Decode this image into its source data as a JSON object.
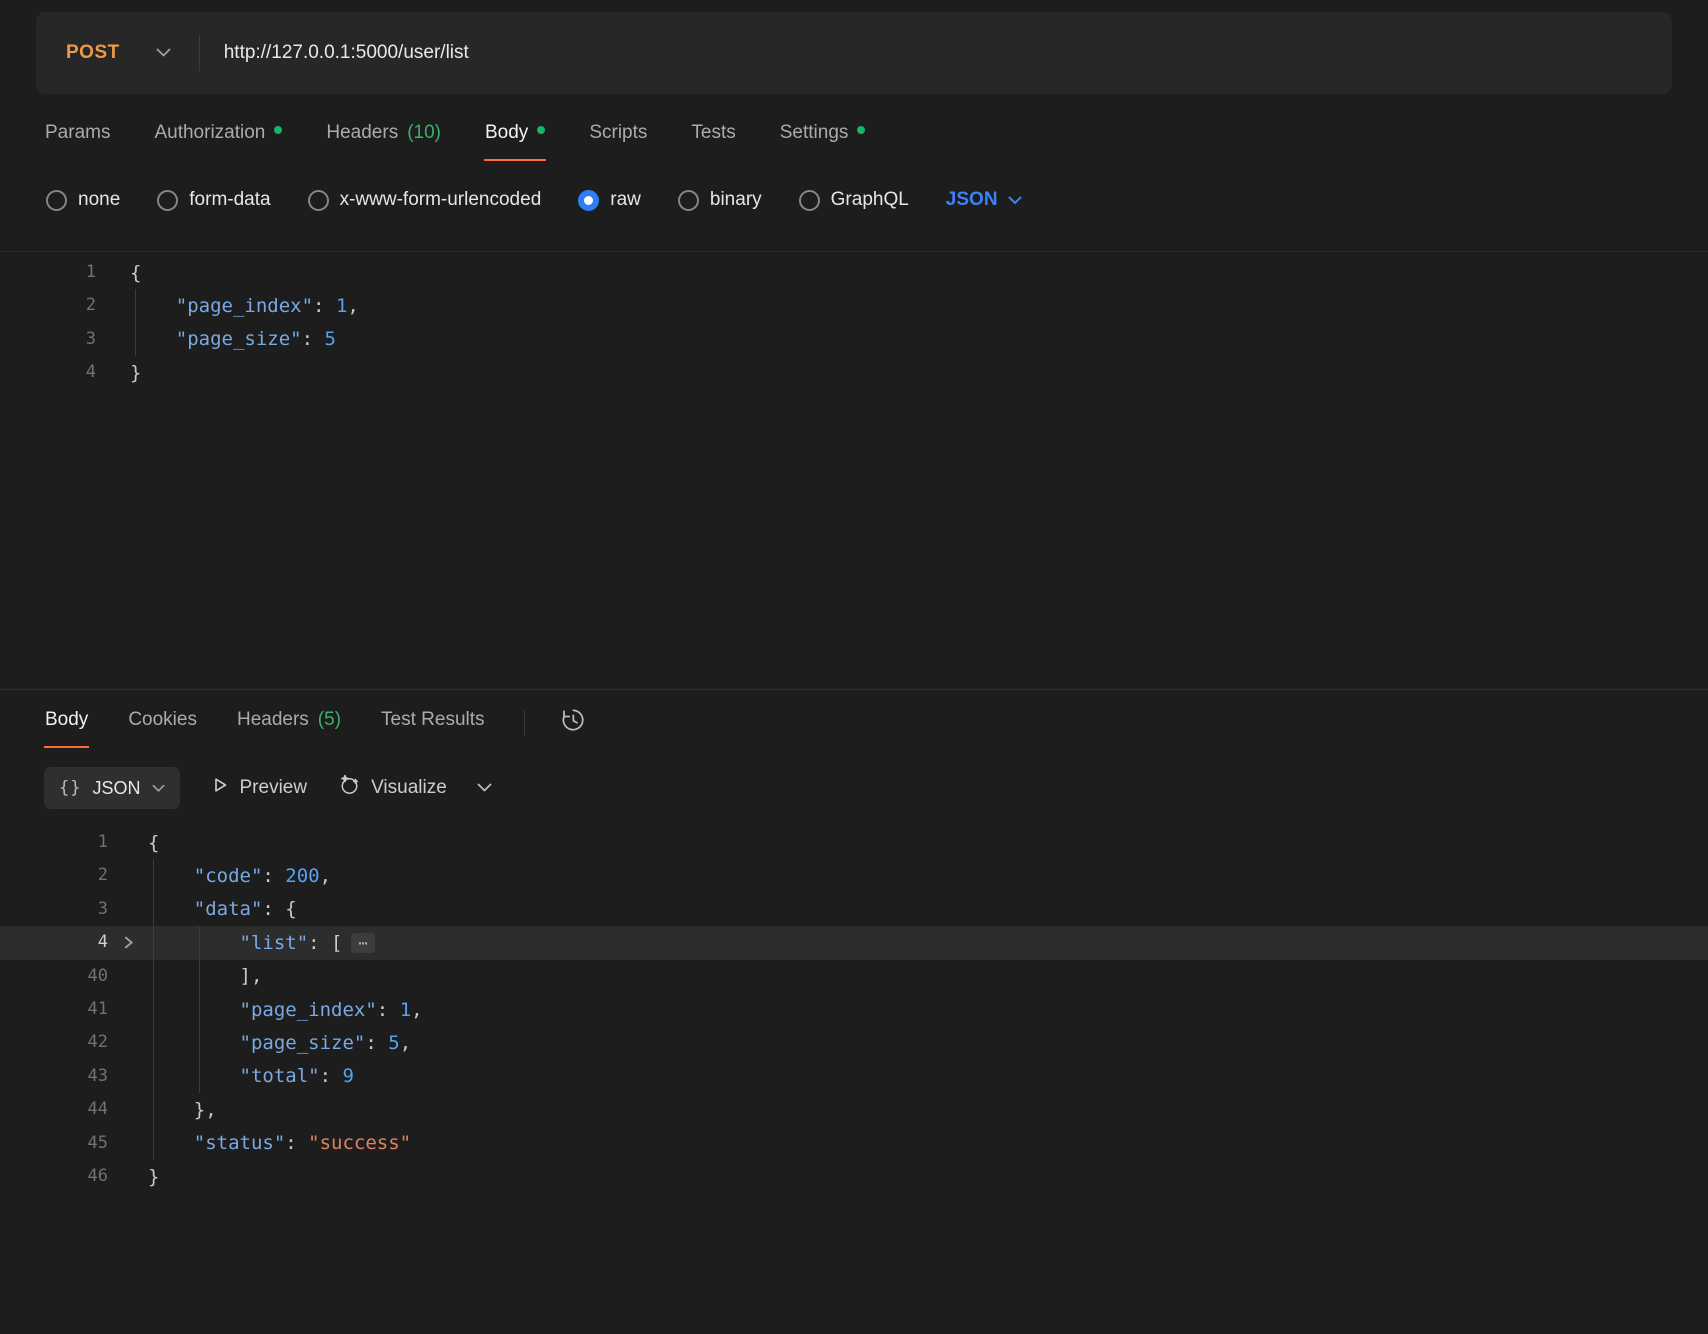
{
  "request": {
    "method": "POST",
    "url": "http://127.0.0.1:5000/user/list",
    "tabs": [
      {
        "label": "Params"
      },
      {
        "label": "Authorization",
        "dot": true
      },
      {
        "label": "Headers",
        "count": "(10)"
      },
      {
        "label": "Body",
        "dot": true,
        "active": true
      },
      {
        "label": "Scripts"
      },
      {
        "label": "Tests"
      },
      {
        "label": "Settings",
        "dot": true
      }
    ],
    "body_types": [
      {
        "label": "none"
      },
      {
        "label": "form-data"
      },
      {
        "label": "x-www-form-urlencoded"
      },
      {
        "label": "raw",
        "selected": true
      },
      {
        "label": "binary"
      },
      {
        "label": "GraphQL"
      }
    ],
    "language_selector": "JSON",
    "editor_lines": [
      {
        "num": "1",
        "tokens": [
          [
            "p",
            "{"
          ]
        ]
      },
      {
        "num": "2",
        "guides": [
          0
        ],
        "tokens": [
          [
            "p",
            "    "
          ],
          [
            "k",
            "\"page_index\""
          ],
          [
            "p",
            ": "
          ],
          [
            "n",
            "1"
          ],
          [
            "p",
            ","
          ]
        ]
      },
      {
        "num": "3",
        "guides": [
          0
        ],
        "tokens": [
          [
            "p",
            "    "
          ],
          [
            "k",
            "\"page_size\""
          ],
          [
            "p",
            ": "
          ],
          [
            "n",
            "5"
          ]
        ]
      },
      {
        "num": "4",
        "tokens": [
          [
            "p",
            "}"
          ]
        ]
      }
    ]
  },
  "response": {
    "tabs": [
      {
        "label": "Body",
        "active": true
      },
      {
        "label": "Cookies"
      },
      {
        "label": "Headers",
        "count": "(5)"
      },
      {
        "label": "Test Results"
      }
    ],
    "toolbar": {
      "format": "JSON",
      "preview": "Preview",
      "visualize": "Visualize"
    },
    "editor_lines": [
      {
        "num": "1",
        "tokens": [
          [
            "p",
            "{"
          ]
        ]
      },
      {
        "num": "2",
        "guides": [
          0
        ],
        "tokens": [
          [
            "p",
            "    "
          ],
          [
            "k",
            "\"code\""
          ],
          [
            "p",
            ": "
          ],
          [
            "n",
            "200"
          ],
          [
            "p",
            ","
          ]
        ]
      },
      {
        "num": "3",
        "guides": [
          0
        ],
        "tokens": [
          [
            "p",
            "    "
          ],
          [
            "k",
            "\"data\""
          ],
          [
            "p",
            ": {"
          ]
        ]
      },
      {
        "num": "4",
        "fold": true,
        "highlight": true,
        "guides": [
          0,
          1
        ],
        "tokens": [
          [
            "p",
            "        "
          ],
          [
            "k",
            "\"list\""
          ],
          [
            "p",
            ": ["
          ],
          [
            "e",
            "⋯"
          ]
        ]
      },
      {
        "num": "40",
        "guides": [
          0,
          1
        ],
        "tokens": [
          [
            "p",
            "        ],"
          ]
        ]
      },
      {
        "num": "41",
        "guides": [
          0,
          1
        ],
        "tokens": [
          [
            "p",
            "        "
          ],
          [
            "k",
            "\"page_index\""
          ],
          [
            "p",
            ": "
          ],
          [
            "n",
            "1"
          ],
          [
            "p",
            ","
          ]
        ]
      },
      {
        "num": "42",
        "guides": [
          0,
          1
        ],
        "tokens": [
          [
            "p",
            "        "
          ],
          [
            "k",
            "\"page_size\""
          ],
          [
            "p",
            ": "
          ],
          [
            "n",
            "5"
          ],
          [
            "p",
            ","
          ]
        ]
      },
      {
        "num": "43",
        "guides": [
          0,
          1
        ],
        "tokens": [
          [
            "p",
            "        "
          ],
          [
            "k",
            "\"total\""
          ],
          [
            "p",
            ": "
          ],
          [
            "n",
            "9"
          ]
        ]
      },
      {
        "num": "44",
        "guides": [
          0
        ],
        "tokens": [
          [
            "p",
            "    },"
          ]
        ]
      },
      {
        "num": "45",
        "guides": [
          0
        ],
        "tokens": [
          [
            "p",
            "    "
          ],
          [
            "k",
            "\"status\""
          ],
          [
            "p",
            ": "
          ],
          [
            "s",
            "\"success\""
          ]
        ]
      },
      {
        "num": "46",
        "tokens": [
          [
            "p",
            "}"
          ]
        ]
      }
    ]
  },
  "colors": {
    "accent_orange": "#ff6c37",
    "method_post_orange": "#eb9b45",
    "modified_dot_green": "#12b76a",
    "count_green": "#3fae68",
    "link_blue": "#3b82f6",
    "json_key_blue": "#79a9e3",
    "json_number_blue": "#58a0f0",
    "json_string_salmon": "#e0825f"
  }
}
